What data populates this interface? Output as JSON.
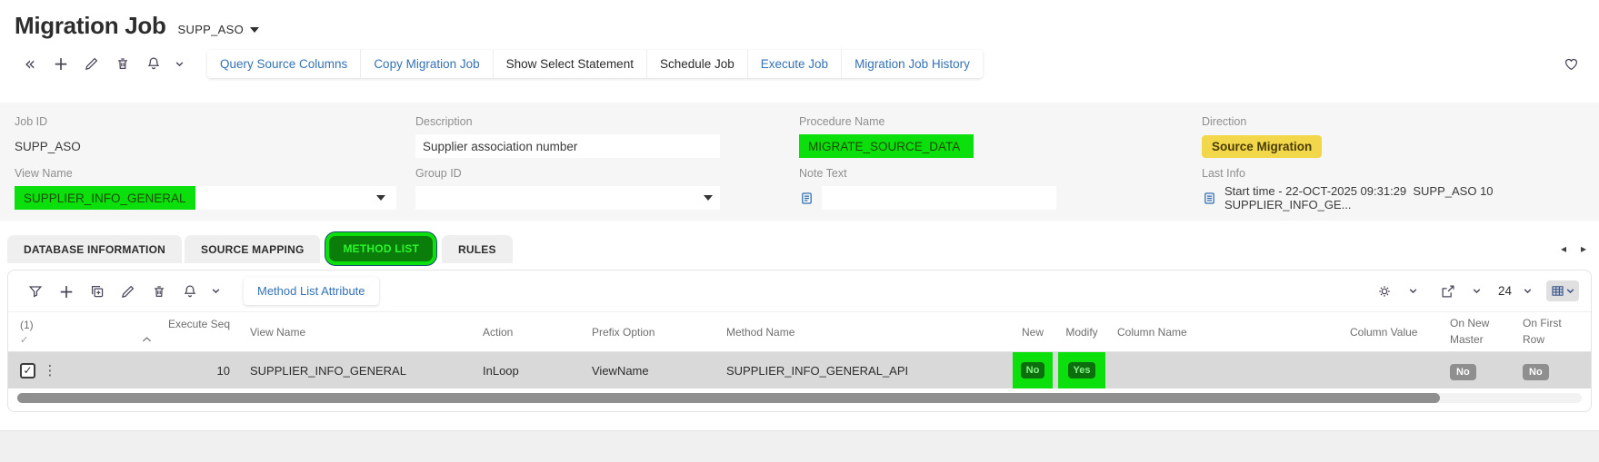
{
  "header": {
    "title": "Migration Job",
    "entity": "SUPP_ASO"
  },
  "commands": {
    "buttons": [
      {
        "label": "Query Source Columns",
        "variant": "link"
      },
      {
        "label": "Copy Migration Job",
        "variant": "link"
      },
      {
        "label": "Show Select Statement",
        "variant": "plain"
      },
      {
        "label": "Schedule Job",
        "variant": "plain"
      },
      {
        "label": "Execute Job",
        "variant": "link"
      },
      {
        "label": "Migration Job History",
        "variant": "link"
      }
    ]
  },
  "form": {
    "job_id": {
      "label": "Job ID",
      "value": "SUPP_ASO"
    },
    "description": {
      "label": "Description",
      "value": "Supplier association number"
    },
    "procedure_name": {
      "label": "Procedure Name",
      "value": "MIGRATE_SOURCE_DATA",
      "highlighted": true
    },
    "direction": {
      "label": "Direction",
      "value": "Source Migration"
    },
    "view_name": {
      "label": "View Name",
      "value": "SUPPLIER_INFO_GENERAL",
      "highlighted": true
    },
    "group_id": {
      "label": "Group ID",
      "value": ""
    },
    "note_text": {
      "label": "Note Text",
      "value": ""
    },
    "last_info": {
      "label": "Last Info",
      "value": "Start time - 22-OCT-2025 09:31:29  SUPP_ASO 10 SUPPLIER_INFO_GE..."
    }
  },
  "tabs": {
    "items": [
      {
        "label": "DATABASE INFORMATION",
        "active": false
      },
      {
        "label": "SOURCE MAPPING",
        "active": false
      },
      {
        "label": "METHOD LIST",
        "active": true
      },
      {
        "label": "RULES",
        "active": false
      }
    ]
  },
  "grid": {
    "toolbar": {
      "attribute_button": "Method List Attribute",
      "page_size": "24"
    },
    "columns": [
      {
        "label": "(1)"
      },
      {
        "label": ""
      },
      {
        "label": "Execute Seq",
        "sorted": "asc"
      },
      {
        "label": "View Name"
      },
      {
        "label": "Action"
      },
      {
        "label": "Prefix Option"
      },
      {
        "label": "Method Name"
      },
      {
        "label": "New"
      },
      {
        "label": "Modify"
      },
      {
        "label": "Column Name"
      },
      {
        "label": "Column Value"
      },
      {
        "label": "On New Master"
      },
      {
        "label": "On First Row"
      }
    ],
    "rows": [
      {
        "selected": true,
        "execute_seq": "10",
        "view_name": "SUPPLIER_INFO_GENERAL",
        "action": "InLoop",
        "prefix_option": "ViewName",
        "method_name": "SUPPLIER_INFO_GENERAL_API",
        "new": "No",
        "new_highlighted": true,
        "modify": "Yes",
        "modify_highlighted": true,
        "column_name": "",
        "column_value": "",
        "on_new_master": "No",
        "on_first_row": "No"
      }
    ]
  },
  "colors": {
    "highlight_green": "#0ce00c",
    "active_tab_green": "#0a7d0a",
    "badge_green_bg": "#0c6e0c",
    "badge_yellow_bg": "#f2d74a",
    "badge_gray_bg": "#8f8f8f",
    "link_blue": "#3572b5"
  }
}
